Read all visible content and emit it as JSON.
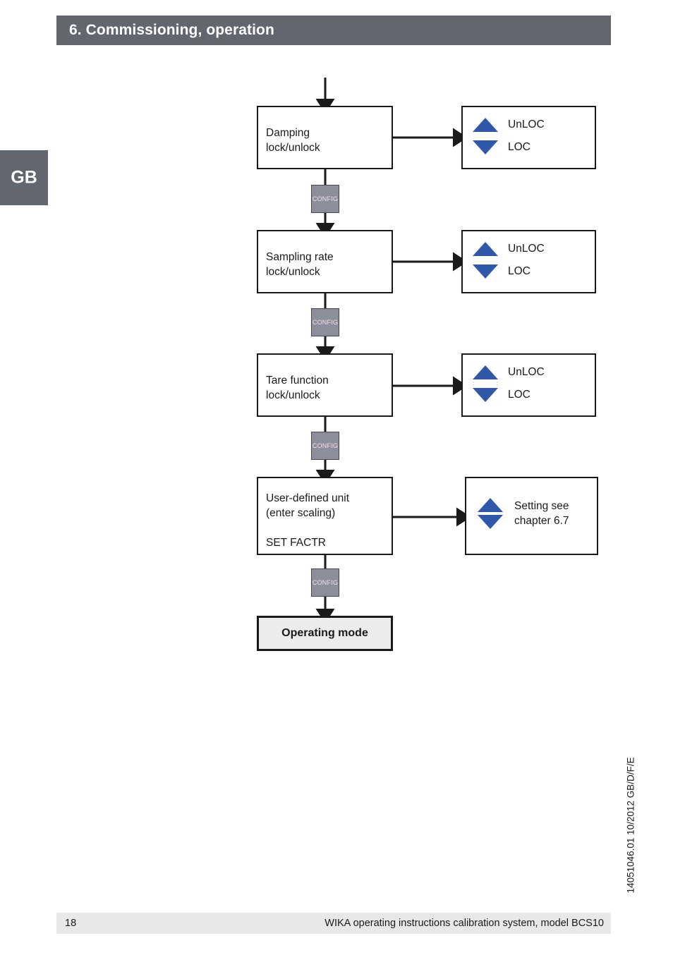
{
  "header": {
    "title": "6. Commissioning, operation"
  },
  "language_tab": {
    "label": "GB"
  },
  "footer": {
    "page_number": "18",
    "text": "WIKA operating instructions calibration system, model BCS10",
    "document_code": "14051046.01 10/2012 GB/D/F/E"
  },
  "flowchart": {
    "config_button_label": "CONFIG",
    "accent_color": "#3158a8",
    "steps": [
      {
        "id": "damping",
        "title": "Damping\nlock/unlock",
        "options": [
          {
            "icon": "triangle-up-icon",
            "label": "UnLOC"
          },
          {
            "icon": "triangle-down-icon",
            "label": "LOC"
          }
        ]
      },
      {
        "id": "sampling-rate",
        "title": "Sampling rate\nlock/unlock",
        "options": [
          {
            "icon": "triangle-up-icon",
            "label": "UnLOC"
          },
          {
            "icon": "triangle-down-icon",
            "label": "LOC"
          }
        ]
      },
      {
        "id": "tare-function",
        "title": "Tare function\nlock/unlock",
        "options": [
          {
            "icon": "triangle-up-icon",
            "label": "UnLOC"
          },
          {
            "icon": "triangle-down-icon",
            "label": "LOC"
          }
        ]
      },
      {
        "id": "user-defined-unit",
        "title": "User-defined unit\n(enter scaling)",
        "subtitle": "SET FACTR",
        "options": [
          {
            "icon": "triangle-stack-icon",
            "label": "Setting see\nchapter 6.7"
          }
        ]
      }
    ],
    "terminal": {
      "label": "Operating mode"
    }
  }
}
